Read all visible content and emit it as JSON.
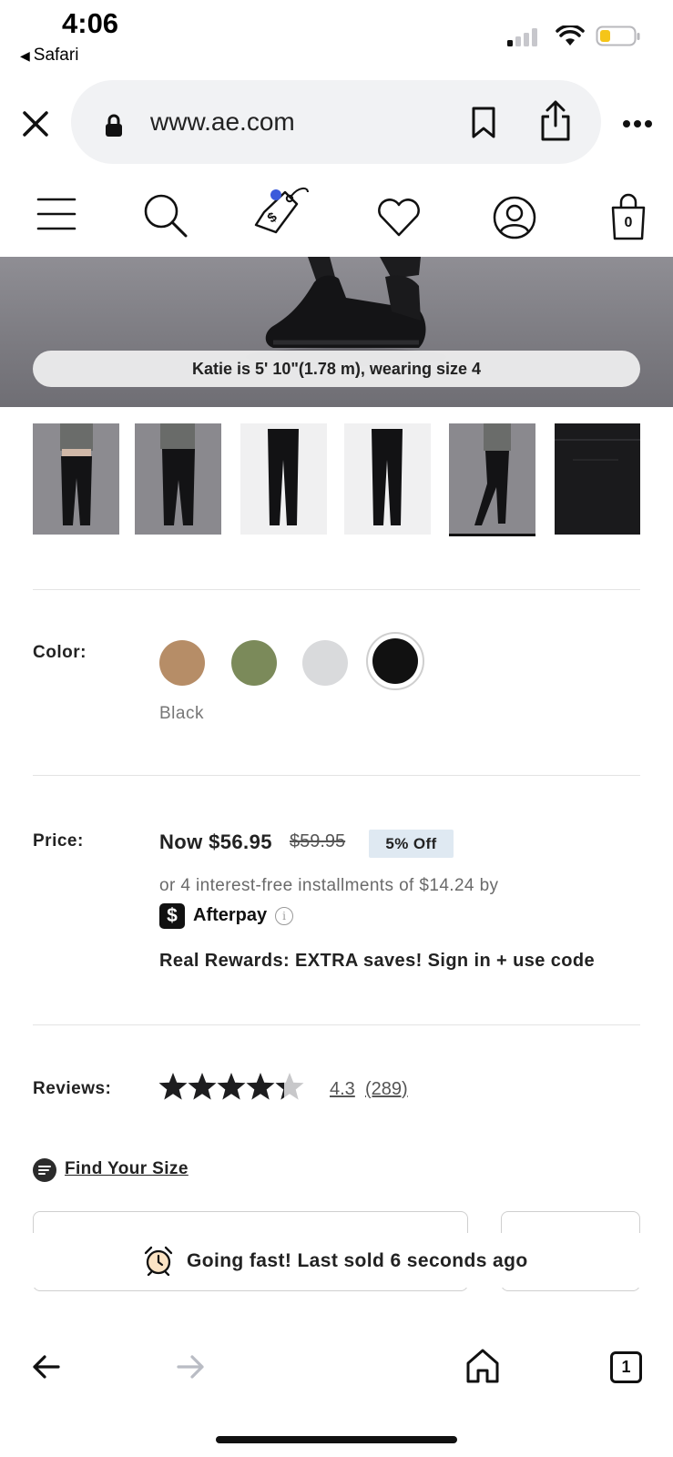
{
  "status_bar": {
    "time": "4:06",
    "back_app": "Safari",
    "battery_color": "#f5c518"
  },
  "browser": {
    "url": "www.ae.com",
    "close_icon": "close-icon",
    "lock_icon": "lock-icon",
    "bookmark_icon": "bookmark-icon",
    "share_icon": "share-icon",
    "more_icon": "more-icon"
  },
  "site_header": {
    "menu_icon": "hamburger-icon",
    "search_icon": "search-icon",
    "deals_icon": "price-tag-icon",
    "wishlist_icon": "heart-icon",
    "account_icon": "account-icon",
    "bag_count": "0",
    "accent_dot_color": "#3b5bdb"
  },
  "hero": {
    "model_caption": "Katie is 5' 10\"(1.78 m), wearing size 4"
  },
  "thumbnails": {
    "count": 6,
    "selected_index": 4
  },
  "color": {
    "label": "Color:",
    "selected_name": "Black",
    "swatches": [
      "#b68d67",
      "#7b8a5a",
      "#d9dadc",
      "#111111"
    ]
  },
  "price": {
    "label": "Price:",
    "now": "Now $56.95",
    "was": "$59.95",
    "discount": "5% Off",
    "installments": "or 4 interest-free installments of $14.24 by",
    "afterpay_logo": "$",
    "afterpay": "Afterpay",
    "info_glyph": "i",
    "rewards": "Real Rewards: EXTRA saves! Sign in + use code"
  },
  "reviews": {
    "label": "Reviews:",
    "rating": "4.3",
    "count": "(289)",
    "stars_value": 4.3
  },
  "find_your_size": {
    "label": "Find Your Size"
  },
  "alert": {
    "text": "Going fast! Last sold 6 seconds ago",
    "icon": "alarm-clock-icon"
  },
  "bottom_nav": {
    "back_icon": "arrow-left-icon",
    "forward_icon": "arrow-right-icon",
    "home_icon": "home-icon",
    "tabs_count": "1"
  }
}
